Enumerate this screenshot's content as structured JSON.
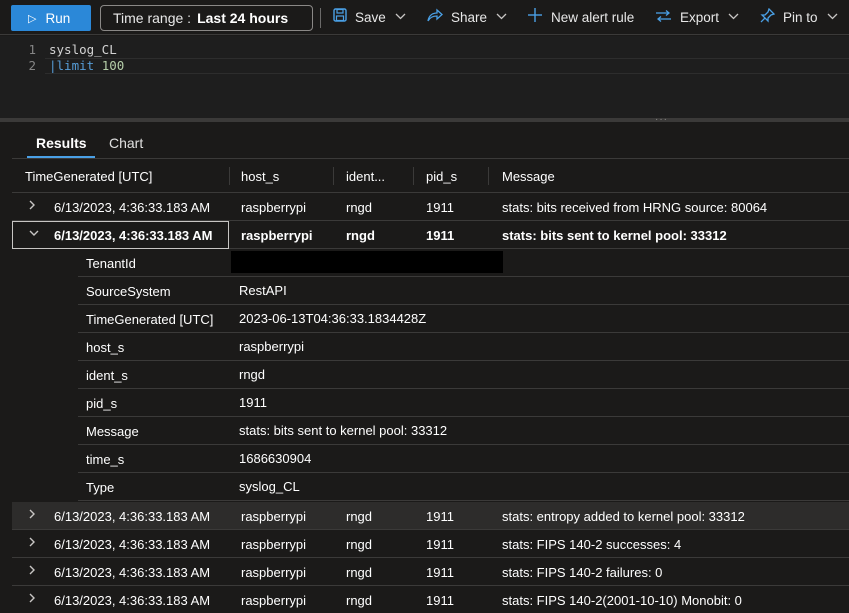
{
  "toolbar": {
    "run_label": "Run",
    "time_range_label": "Time range :",
    "time_range_value": "Last 24 hours",
    "save_label": "Save",
    "share_label": "Share",
    "new_alert_label": "New alert rule",
    "export_label": "Export",
    "pin_label": "Pin to"
  },
  "editor": {
    "lines": [
      {
        "num": "1",
        "text": "syslog_CL"
      },
      {
        "num": "2",
        "pipe": "|",
        "keyword": "limit",
        "value": "100"
      }
    ]
  },
  "tabs": [
    {
      "label": "Results",
      "active": true
    },
    {
      "label": "Chart",
      "active": false
    }
  ],
  "columns": [
    "TimeGenerated [UTC]",
    "host_s",
    "ident...",
    "pid_s",
    "Message"
  ],
  "rows": [
    {
      "time": "6/13/2023, 4:36:33.183 AM",
      "host": "raspberrypi",
      "ident": "rngd",
      "pid": "1911",
      "message": "stats: bits received from HRNG source: 80064",
      "expanded": false
    },
    {
      "time": "6/13/2023, 4:36:33.183 AM",
      "host": "raspberrypi",
      "ident": "rngd",
      "pid": "1911",
      "message": "stats: bits sent to kernel pool: 33312",
      "expanded": true
    },
    {
      "time": "6/13/2023, 4:36:33.183 AM",
      "host": "raspberrypi",
      "ident": "rngd",
      "pid": "1911",
      "message": "stats: entropy added to kernel pool: 33312",
      "expanded": false
    },
    {
      "time": "6/13/2023, 4:36:33.183 AM",
      "host": "raspberrypi",
      "ident": "rngd",
      "pid": "1911",
      "message": "stats: FIPS 140-2 successes: 4",
      "expanded": false
    },
    {
      "time": "6/13/2023, 4:36:33.183 AM",
      "host": "raspberrypi",
      "ident": "rngd",
      "pid": "1911",
      "message": "stats: FIPS 140-2 failures: 0",
      "expanded": false
    },
    {
      "time": "6/13/2023, 4:36:33.183 AM",
      "host": "raspberrypi",
      "ident": "rngd",
      "pid": "1911",
      "message": "stats: FIPS 140-2(2001-10-10) Monobit: 0",
      "expanded": false
    }
  ],
  "details": [
    {
      "key": "TenantId",
      "value": ""
    },
    {
      "key": "SourceSystem",
      "value": "RestAPI"
    },
    {
      "key": "TimeGenerated [UTC]",
      "value": "2023-06-13T04:36:33.1834428Z"
    },
    {
      "key": "host_s",
      "value": "raspberrypi"
    },
    {
      "key": "ident_s",
      "value": "rngd"
    },
    {
      "key": "pid_s",
      "value": "1911"
    },
    {
      "key": "Message",
      "value": "stats: bits sent to kernel pool: 33312"
    },
    {
      "key": "time_s",
      "value": "1686630904"
    },
    {
      "key": "Type",
      "value": "syslog_CL"
    }
  ],
  "icons": {
    "play": "play-icon",
    "save": "save-icon",
    "share": "share-icon",
    "add": "plus-icon",
    "export": "export-icon",
    "pin": "pin-icon",
    "chevron": "chevron-down-icon",
    "expand": "chevron-right-icon",
    "collapse": "chevron-down-icon"
  },
  "colors": {
    "accent": "#2b88d8",
    "icon_blue": "#4aa0e6",
    "background": "#1b1a19"
  }
}
